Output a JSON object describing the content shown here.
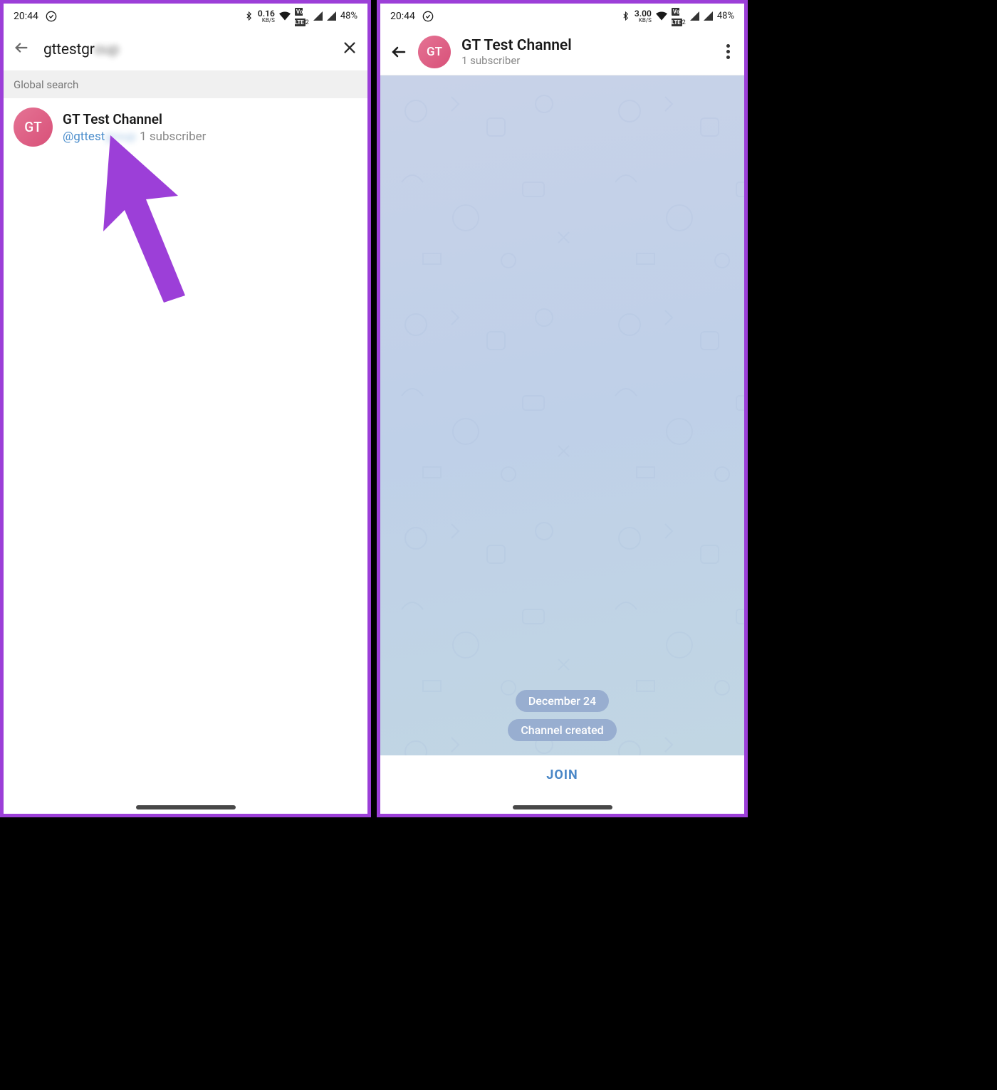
{
  "status_bar": {
    "time": "20:44",
    "speed1": "0.16",
    "speed2": "3.00",
    "speed_unit": "KB/S",
    "lte": "LTE",
    "lte_sim": "2",
    "battery": "48%"
  },
  "search": {
    "query_visible": "gttestgr",
    "query_blurred": "oup"
  },
  "section": {
    "global": "Global search"
  },
  "result": {
    "avatar": "GT",
    "name": "GT Test Channel",
    "handle": "@gttest",
    "handle_blur": "group",
    "subscribers": "1 subscriber"
  },
  "channel": {
    "avatar": "GT",
    "title": "GT Test Channel",
    "sub": "1 subscriber"
  },
  "chat": {
    "date": "December 24",
    "event": "Channel created"
  },
  "join_button": "JOIN"
}
